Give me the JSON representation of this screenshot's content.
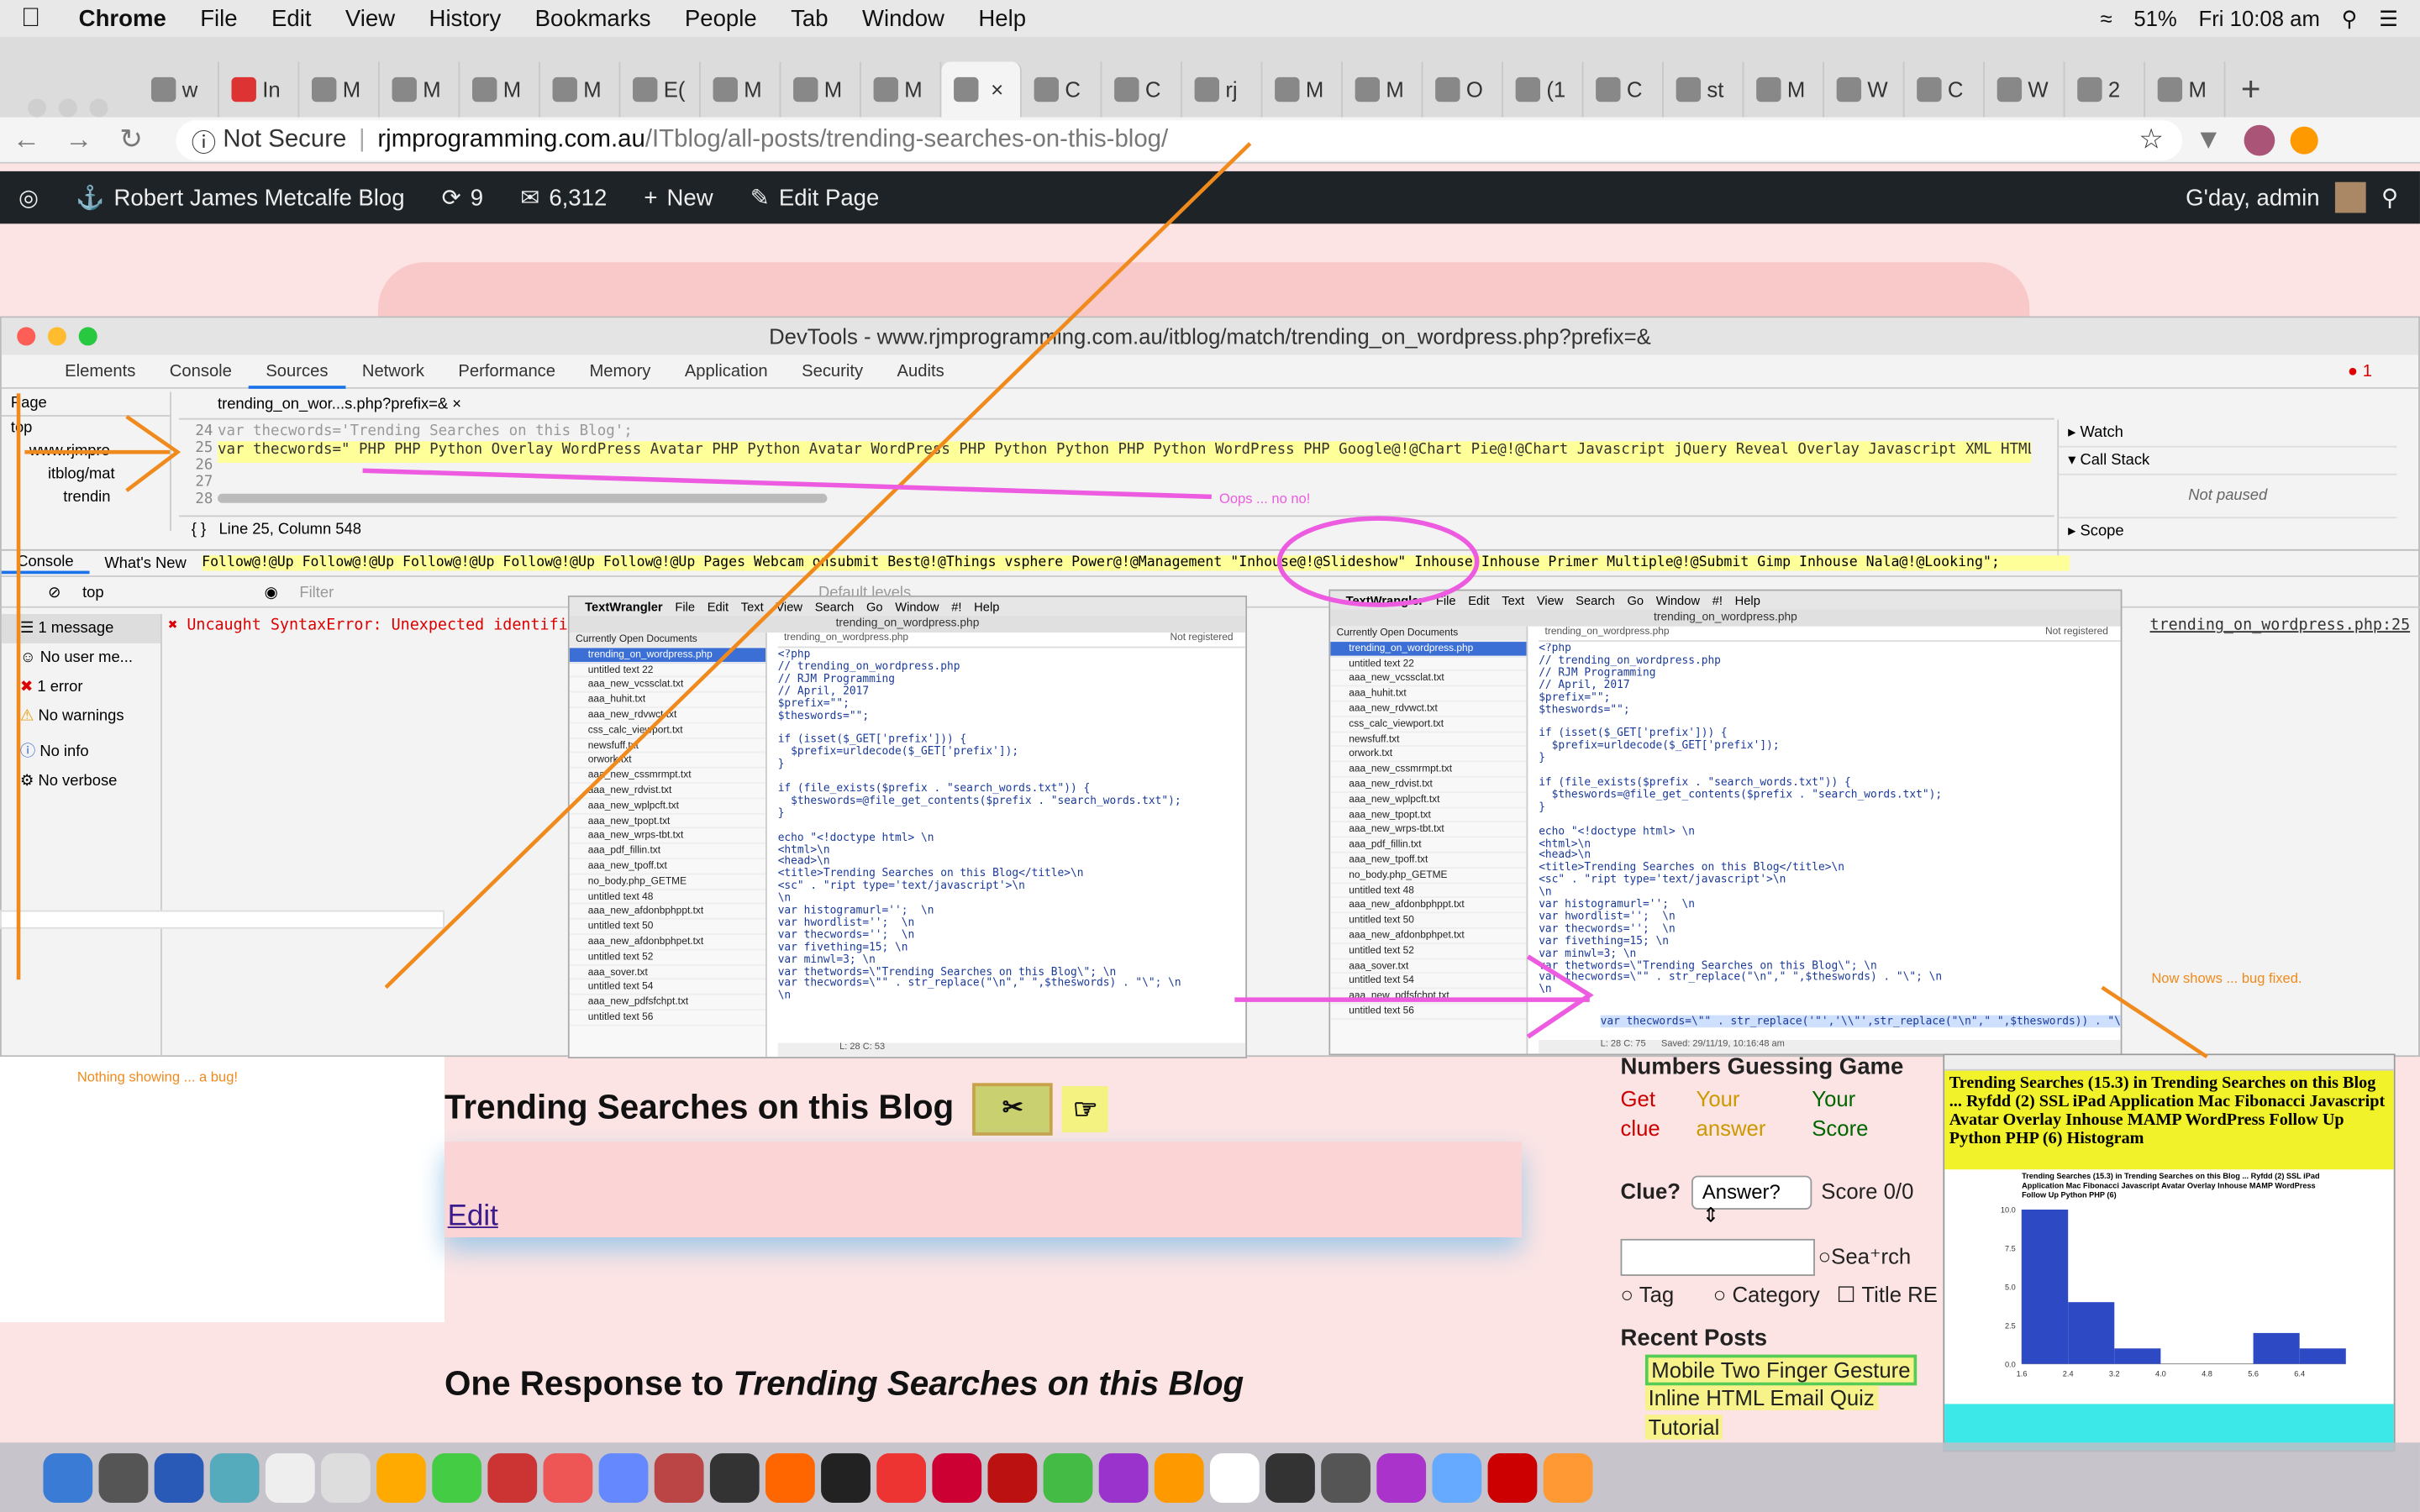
{
  "menubar": {
    "app": "Chrome",
    "items": [
      "File",
      "Edit",
      "View",
      "History",
      "Bookmarks",
      "People",
      "Tab",
      "Window",
      "Help"
    ],
    "battery": "51%",
    "clock": "Fri 10:08 am"
  },
  "tabs": [
    "w",
    "In",
    "M",
    "M",
    "M",
    "M",
    "E(",
    "M",
    "M",
    "M",
    "",
    "C",
    "C",
    "rj",
    "M",
    "M",
    "O",
    "(1",
    "C",
    "st",
    "M",
    "W",
    "C",
    "W",
    "2",
    "M"
  ],
  "address": {
    "security": "Not Secure",
    "host": "rjmprogramming.com.au",
    "path": "/ITblog/all-posts/trending-searches-on-this-blog/"
  },
  "wpbar": {
    "site": "Robert James Metcalfe Blog",
    "updates": "9",
    "comments": "6,312",
    "new": "New",
    "edit": "Edit Page",
    "greeting": "G'day, admin"
  },
  "devtools": {
    "title": "DevTools - www.rjmprogramming.com.au/itblog/match/trending_on_wordpress.php?prefix=&",
    "tabs": [
      "Elements",
      "Console",
      "Sources",
      "Network",
      "Performance",
      "Memory",
      "Application",
      "Security",
      "Audits"
    ],
    "error_count": "1",
    "page_tab": "Page",
    "file_tab": "trending_on_wor...s.php?prefix=&",
    "tree": [
      "top",
      "www.rjmpro",
      "itblog/mat",
      "trendin"
    ],
    "line_numbers": [
      "24",
      "25",
      "26",
      "27",
      "28"
    ],
    "line24": "var thecwords='Trending Searches on this Blog';",
    "line25": "var thecwords=\"  PHP PHP Python Overlay WordPress Avatar PHP Python Avatar WordPress PHP Python Python PHP Python WordPress PHP Google@!@Chart Pie@!@Chart Javascript jQuery Reveal Overlay Javascript XML HTML PDF MySql",
    "status": "Line 25, Column 548",
    "oops": "Oops ... no no!",
    "watch": "Watch",
    "callstack": "Call Stack",
    "not_paused": "Not paused",
    "scope": "Scope",
    "console_tabs": [
      "Console",
      "What's New"
    ],
    "console_line": "Follow@!@Up Follow@!@Up Follow@!@Up Follow@!@Up Follow@!@Up Pages Webcam onsubmit Best@!@Things vsphere Power@!@Management \"Inhouse@!@Slideshow\" Inhouse Inhouse Primer Multiple@!@Submit Gimp Inhouse Nala@!@Looking\";",
    "context": "top",
    "filter": "Filter",
    "default_levels": "Default levels",
    "sidebar": [
      "1 message",
      "No user me...",
      "1 error",
      "No warnings",
      "No info",
      "No verbose"
    ],
    "error": "Uncaught SyntaxError: Unexpected identifier",
    "error_link": "trending_on_wordpress.php:25"
  },
  "textwrangler": {
    "menu": [
      "TextWrangler",
      "File",
      "Edit",
      "Text",
      "View",
      "Search",
      "Go",
      "Window",
      "#!",
      "Help"
    ],
    "filename": "trending_on_wordpress.php",
    "not_registered": "Not registered",
    "open_docs_label": "Currently Open Documents",
    "docs": [
      "trending_on_wordpress.php",
      "untitled text 22",
      "aaa_new_vcssclat.txt",
      "aaa_huhit.txt",
      "aaa_new_rdvwct.txt",
      "css_calc_viewport.txt",
      "newsfuff.txt",
      "orwork.txt",
      "aaa_new_cssmrmpt.txt",
      "aaa_new_rdvist.txt",
      "aaa_new_wplpcft.txt",
      "aaa_new_tpopt.txt",
      "aaa_new_wrps-tbt.txt",
      "aaa_pdf_fillin.txt",
      "aaa_new_tpoff.txt",
      "no_body.php_GETME",
      "untitled text 48",
      "aaa_new_afdonbphppt.txt",
      "untitled text 50",
      "aaa_new_afdonbphpet.txt",
      "untitled text 52",
      "aaa_sover.txt",
      "untitled text 54",
      "aaa_new_pdfsfchpt.txt",
      "untitled text 56"
    ],
    "code_left": "<?php\n// trending_on_wordpress.php\n// RJM Programming\n// April, 2017\n$prefix=\"\";\n$theswords=\"\";\n\nif (isset($_GET['prefix'])) {\n  $prefix=urldecode($_GET['prefix']);\n}\n\nif (file_exists($prefix . \"search_words.txt\")) {\n  $theswords=@file_get_contents($prefix . \"search_words.txt\");\n}\n\necho \"<!doctype html> \\n\n<html>\\n\n<head>\\n\n<title>Trending Searches on this Blog</title>\\n\n<sc\" . \"ript type='text/javascript'>\\n\n\\n\nvar histogramurl='';  \\n\nvar hwordlist='';  \\n\nvar thecwords='';  \\n\nvar fivething=15; \\n\nvar minwl=3; \\n\nvar thetwords=\\\"Trending Searches on this Blog\\\"; \\n\nvar thecwords=\\\"\" . str_replace(\"\\n\",\" \",$theswords) . \"\\\"; \\n\n\\n",
    "code_right_last": "var thecwords=\\\"\" . str_replace('\"','\\\\\"',str_replace(\"\\n\",\" \",$theswords)) . \"\\\"; \\n",
    "status_left": "L: 28 C: 53",
    "status_right": "L: 28 C: 75",
    "saved": "Saved: 29/11/19, 10:16:48 am"
  },
  "notes": {
    "bug": "Nothing showing ... a bug!",
    "fixed": "Now shows ... bug fixed."
  },
  "page": {
    "title": "Trending Searches on this Blog",
    "edit": "Edit",
    "response": "One Response to",
    "response_em": "Trending Searches on this Blog",
    "game_title": "Numbers Guessing Game",
    "game_cols": [
      "Get clue",
      "Your answer",
      "Your Score"
    ],
    "clue_label": "Clue?",
    "answer_select": "Answer?",
    "score": "Score 0/0",
    "search_label": "Sea⁺rch",
    "tag": "Tag",
    "category": "Category",
    "title_re": "Title RE",
    "recent_posts": "Recent Posts",
    "recent": [
      "Mobile Two Finger Gesture",
      "Inline HTML Email Quiz",
      "Tutorial"
    ]
  },
  "histogram": {
    "heading": "Trending Searches (15.3) in Trending Searches on this Blog ... Ryfdd (2) SSL iPad Application Mac Fibonacci Javascript Avatar Overlay Inhouse MAMP WordPress Follow Up Python PHP (6) Histogram",
    "chart_title": "Trending Searches (15.3) in Trending Searches on this Blog ... Ryfdd (2) SSL iPad Application Mac Fibonacci Javascript Avatar Overlay Inhouse MAMP WordPress Follow Up Python PHP (6)"
  },
  "chart_data": {
    "type": "bar",
    "x": [
      "1.6",
      "2.4",
      "3.2",
      "4.0",
      "4.8",
      "5.6",
      "6.4"
    ],
    "values": [
      10,
      4,
      1,
      0,
      0,
      2,
      1
    ],
    "yticks": [
      "0.0",
      "2.5",
      "5.0",
      "7.5",
      "10.0"
    ],
    "ylim": [
      0,
      10
    ]
  },
  "colors": {
    "wpbar": "#1d2327",
    "highlight_line": "#ffff99",
    "pink_annotation": "#ec5be0",
    "orange_annotation": "#f08a1c",
    "histogram_bar": "#2e49c4",
    "histogram_header": "#f2f22a",
    "histogram_footer": "#3ce8e8"
  }
}
